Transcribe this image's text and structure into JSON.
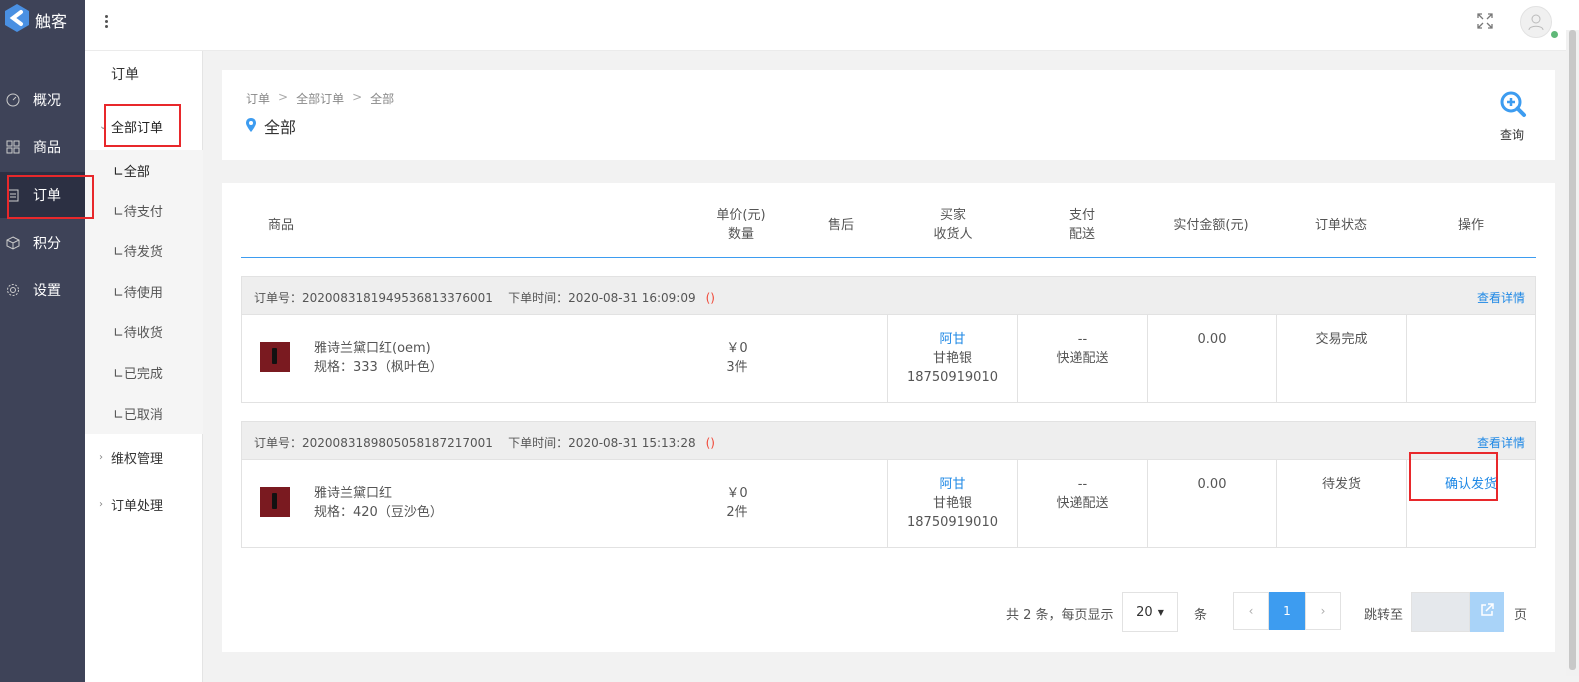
{
  "app": {
    "name": "触客"
  },
  "left_nav": [
    {
      "id": "overview",
      "label": "概况",
      "icon": "dashboard-icon"
    },
    {
      "id": "goods",
      "label": "商品",
      "icon": "grid-icon"
    },
    {
      "id": "orders",
      "label": "订单",
      "icon": "order-icon",
      "active": true
    },
    {
      "id": "points",
      "label": "积分",
      "icon": "cube-icon"
    },
    {
      "id": "settings",
      "label": "设置",
      "icon": "gear-icon"
    }
  ],
  "sub_nav": {
    "title": "订单",
    "groups": [
      {
        "label": "全部订单",
        "expanded": true
      },
      {
        "label": "维权管理",
        "expanded": false
      },
      {
        "label": "订单处理",
        "expanded": false
      }
    ],
    "items": [
      "全部",
      "待支付",
      "待发货",
      "待使用",
      "待收货",
      "已完成",
      "已取消"
    ],
    "item_prefix": "∟",
    "active_item": "全部"
  },
  "breadcrumb": [
    "订单",
    "全部订单",
    "全部"
  ],
  "breadcrumb_sep": ">",
  "page_title": "全部",
  "query_label": "查询",
  "table": {
    "headers": {
      "goods": "商品",
      "price_line1": "单价(元)",
      "price_line2": "数量",
      "after_sale": "售后",
      "buyer_line1": "买家",
      "buyer_line2": "收货人",
      "pay_line1": "支付",
      "pay_line2": "配送",
      "paid": "实付金额(元)",
      "status": "订单状态",
      "action": "操作"
    }
  },
  "orders": [
    {
      "meta": "订单号：20200831819495368133760​01   下单时间：2020-08-31 16:09:09",
      "order_no_label": "订单号：",
      "order_no": "202008318194953681337600​1",
      "time_label": "下单时间：",
      "time": "2020-08-31 16:09:09",
      "paren": "()",
      "detail_link": "查看详情",
      "product": "雅诗兰黛口红(oem)",
      "spec": "规格：333（枫叶色）",
      "price": "￥0",
      "qty": "3件",
      "buyer": "阿甘",
      "receiver": "甘艳银",
      "phone": "18750919010",
      "pay": "--",
      "delivery": "快递配送",
      "paid": "0.00",
      "status": "交易完成",
      "action": ""
    },
    {
      "order_no_label": "订单号：",
      "order_no": "20200831898050581872170​01",
      "time_label": "下单时间：",
      "time": "2020-08-31 15:13:28",
      "paren": "()",
      "detail_link": "查看详情",
      "product": "雅诗兰黛口红",
      "spec": "规格：420（豆沙色）",
      "price": "￥0",
      "qty": "2件",
      "buyer": "阿甘",
      "receiver": "甘艳银",
      "phone": "18750919010",
      "pay": "--",
      "delivery": "快递配送",
      "paid": "0.00",
      "status": "待发货",
      "action": "确认发货"
    }
  ],
  "pagination": {
    "summary": "共 2 条，每页显示",
    "page_size": "20",
    "unit": "条",
    "prev": "‹",
    "current": "1",
    "next": "›",
    "jump_label": "跳转至",
    "page_word": "页"
  },
  "colors": {
    "accent": "#3d9cf0",
    "link": "#1e88e5",
    "nav_bg": "#3e4358",
    "highlight": "#e8282b"
  }
}
